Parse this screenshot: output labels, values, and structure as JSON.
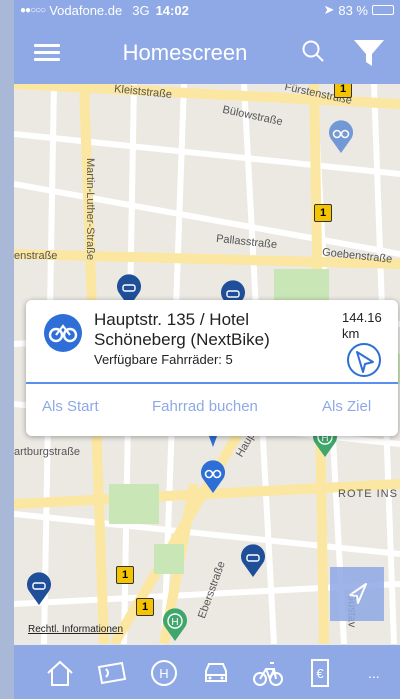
{
  "status_bar": {
    "signal": "●●○○○",
    "carrier": "Vodafone.de",
    "network": "3G",
    "time": "14:02",
    "battery": "83 %",
    "battery_level": 0.83
  },
  "header": {
    "title": "Homescreen",
    "icons": [
      "menu-icon",
      "search-icon",
      "filter-icon"
    ],
    "color": "#8fa9e6"
  },
  "map": {
    "streets": [
      "Kleiststraße",
      "Fürstenstraße",
      "Bülowstraße",
      "Martin-Luther-Straße",
      "enstraße",
      "Pallasstraße",
      "Goebenstraße",
      "artburgstraße",
      "ROTE INS",
      "Hauptstraße",
      "Ebersstraße",
      "Gustav"
    ],
    "badge": "1"
  },
  "popup": {
    "title": "Hauptstr. 135 / Hotel Schöneberg (NextBike)",
    "available": "Verfügbare Fahrräder: 5",
    "distance_value": "144.16",
    "distance_unit": "km",
    "actions": {
      "start": "Als Start",
      "book": "Fahrrad buchen",
      "goal": "Als Ziel"
    }
  },
  "legal_link": "Rechtl. Informationen",
  "tabbar": {
    "tabs": [
      "home-icon",
      "ticket-icon",
      "parking-icon",
      "car-icon",
      "bike-icon",
      "ticket-euro-icon"
    ],
    "more": "..."
  }
}
